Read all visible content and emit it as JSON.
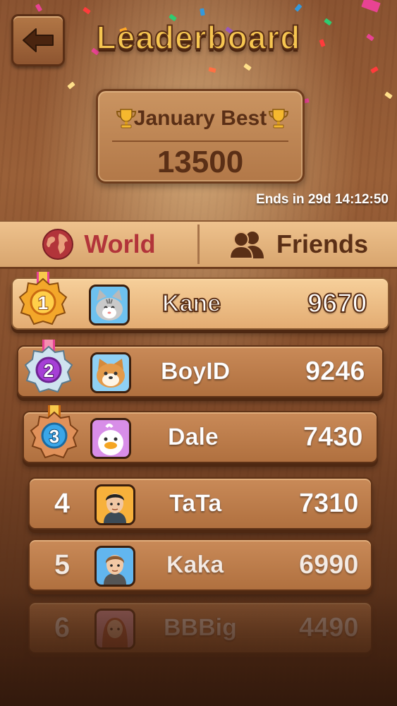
{
  "header": {
    "title": "Leaderboard",
    "back_icon": "arrow-left-icon"
  },
  "best": {
    "title": "January Best",
    "score": "13500",
    "icon": "trophy-icon"
  },
  "timer": "Ends in 29d 14:12:50",
  "tabs": [
    {
      "label": "World",
      "icon": "globe-icon",
      "active": true
    },
    {
      "label": "Friends",
      "icon": "friends-icon",
      "active": false
    }
  ],
  "rows": [
    {
      "rank": "1",
      "name": "Kane",
      "score": "9670",
      "avatar": "cat-avatar"
    },
    {
      "rank": "2",
      "name": "BoyID",
      "score": "9246",
      "avatar": "dog-avatar"
    },
    {
      "rank": "3",
      "name": "Dale",
      "score": "7430",
      "avatar": "duck-avatar"
    },
    {
      "rank": "4",
      "name": "TaTa",
      "score": "7310",
      "avatar": "man-avatar"
    },
    {
      "rank": "5",
      "name": "Kaka",
      "score": "6990",
      "avatar": "boy-avatar"
    },
    {
      "rank": "6",
      "name": "BBBig",
      "score": "4490",
      "avatar": "woman-avatar"
    }
  ],
  "colors": {
    "title": "#f6c651",
    "wood_dark": "#5a2f16",
    "world_red": "#b2343a"
  }
}
